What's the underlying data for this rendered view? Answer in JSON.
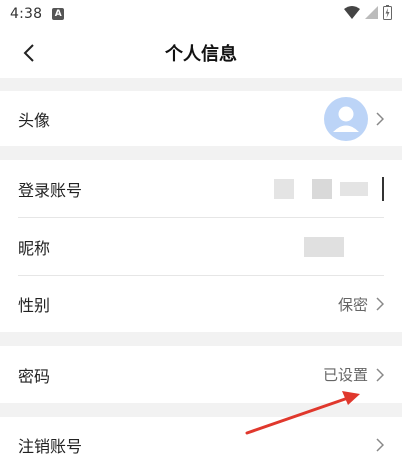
{
  "status_bar": {
    "time": "4:38",
    "notification_letter": "A",
    "icons": [
      "wifi-icon",
      "signal-icon",
      "battery-charging-icon"
    ]
  },
  "header": {
    "title": "个人信息",
    "back_icon": "chevron-left-icon"
  },
  "rows": {
    "avatar": {
      "label": "头像",
      "icon": "user-silhouette-icon"
    },
    "login_account": {
      "label": "登录账号",
      "value_redacted": true
    },
    "nickname": {
      "label": "昵称",
      "value_redacted": true
    },
    "gender": {
      "label": "性别",
      "value": "保密"
    },
    "password": {
      "label": "密码",
      "value": "已设置"
    },
    "deactivate": {
      "label": "注销账号"
    }
  },
  "annotation": {
    "type": "red-arrow",
    "points_to": "password-row"
  },
  "colors": {
    "background": "#f2f2f2",
    "card": "#ffffff",
    "avatar_bg": "#bcd4f7",
    "arrow": "#e0382d",
    "chevron": "#888888"
  }
}
